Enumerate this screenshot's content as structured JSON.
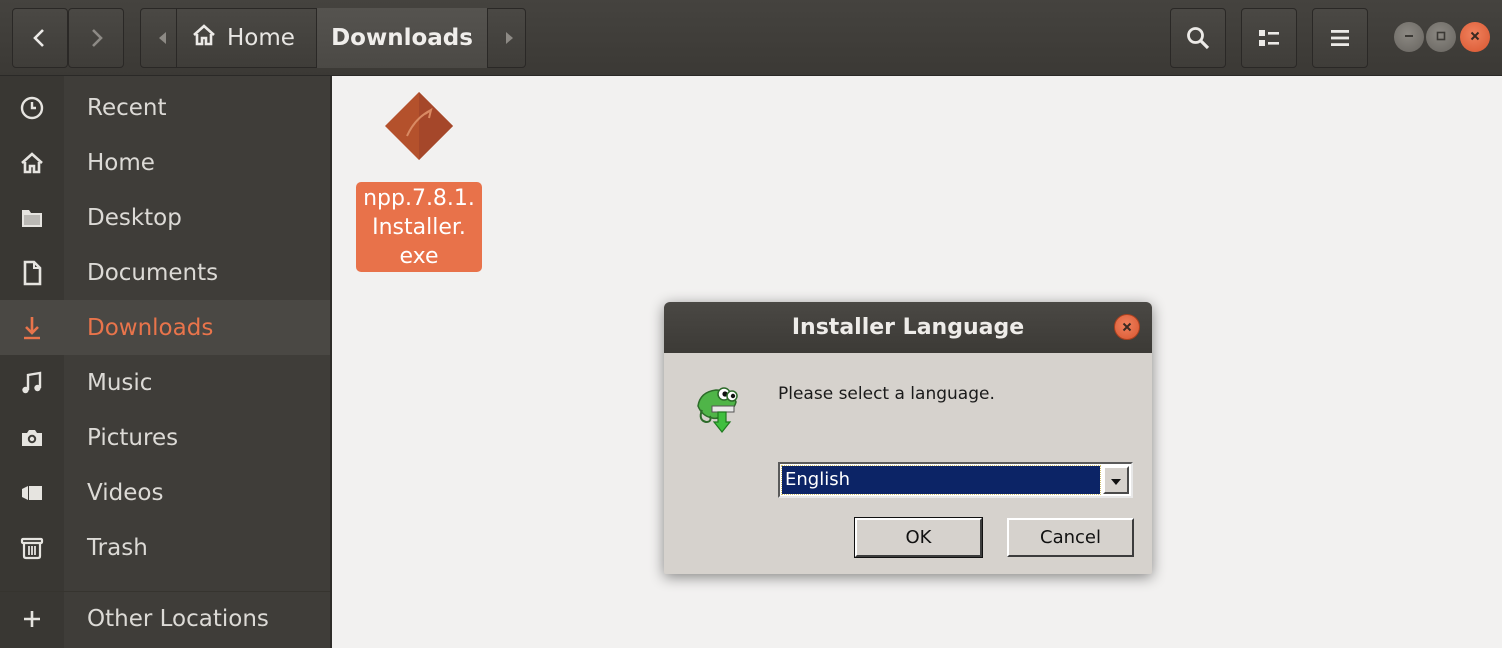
{
  "header": {
    "breadcrumbs": [
      {
        "label": "Home",
        "icon": "home-icon"
      },
      {
        "label": "Downloads",
        "current": true
      }
    ],
    "buttons": [
      "back-icon",
      "forward-icon",
      "search-icon",
      "view-list-icon",
      "menu-icon"
    ]
  },
  "sidebar": {
    "items": [
      {
        "label": "Recent",
        "icon": "clock-icon"
      },
      {
        "label": "Home",
        "icon": "home-icon"
      },
      {
        "label": "Desktop",
        "icon": "folder-icon"
      },
      {
        "label": "Documents",
        "icon": "document-icon"
      },
      {
        "label": "Downloads",
        "icon": "download-icon",
        "active": true
      },
      {
        "label": "Music",
        "icon": "music-icon"
      },
      {
        "label": "Pictures",
        "icon": "camera-icon"
      },
      {
        "label": "Videos",
        "icon": "video-icon"
      },
      {
        "label": "Trash",
        "icon": "trash-icon"
      },
      {
        "label": "Other Locations",
        "icon": "plus-icon"
      }
    ]
  },
  "files": [
    {
      "name_lines": [
        "npp.7.8.1.",
        "Installer.",
        "exe"
      ],
      "selected": true
    }
  ],
  "dialog": {
    "title": "Installer Language",
    "message": "Please select a language.",
    "selected_language": "English",
    "ok_label": "OK",
    "cancel_label": "Cancel"
  },
  "colors": {
    "accent": "#e9744b",
    "headerbar": "#3f3d39",
    "sidebar": "#3f3d39",
    "selection_blue": "#0c2466",
    "dialog_bg": "#d6d2cd"
  }
}
